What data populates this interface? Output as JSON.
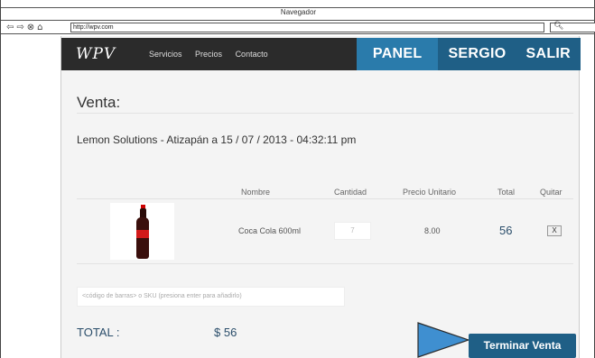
{
  "browser": {
    "title": "Navegador",
    "url": "http://wpv.com",
    "nav_icons": [
      "back-icon",
      "forward-icon",
      "stop-icon",
      "home-icon"
    ],
    "search_icon": "search-icon"
  },
  "app": {
    "logo": "WPV",
    "menu": [
      "Servicios",
      "Precios",
      "Contacto"
    ],
    "actions": {
      "panel": "PANEL",
      "user": "SERGIO",
      "logout": "SALIR"
    },
    "accent_color": "#1f5f86"
  },
  "sale": {
    "heading": "Venta:",
    "subtitle": "Lemon Solutions - Atizapán a 15 / 07 / 2013 - 04:32:11 pm",
    "columns": {
      "name": "Nombre",
      "quantity": "Cantidad",
      "unit_price": "Precio Unitario",
      "total": "Total",
      "remove": "Quitar"
    },
    "items": [
      {
        "name": "Coca Cola 600ml",
        "quantity": "7",
        "unit_price": "8.00",
        "total": "56",
        "remove": "X"
      }
    ],
    "barcode_placeholder": "<código de barras> o SKU (presiona enter para añadirlo)",
    "total_label": "TOTAL :",
    "total_amount": "$ 56",
    "finish_button": "Terminar Venta"
  }
}
